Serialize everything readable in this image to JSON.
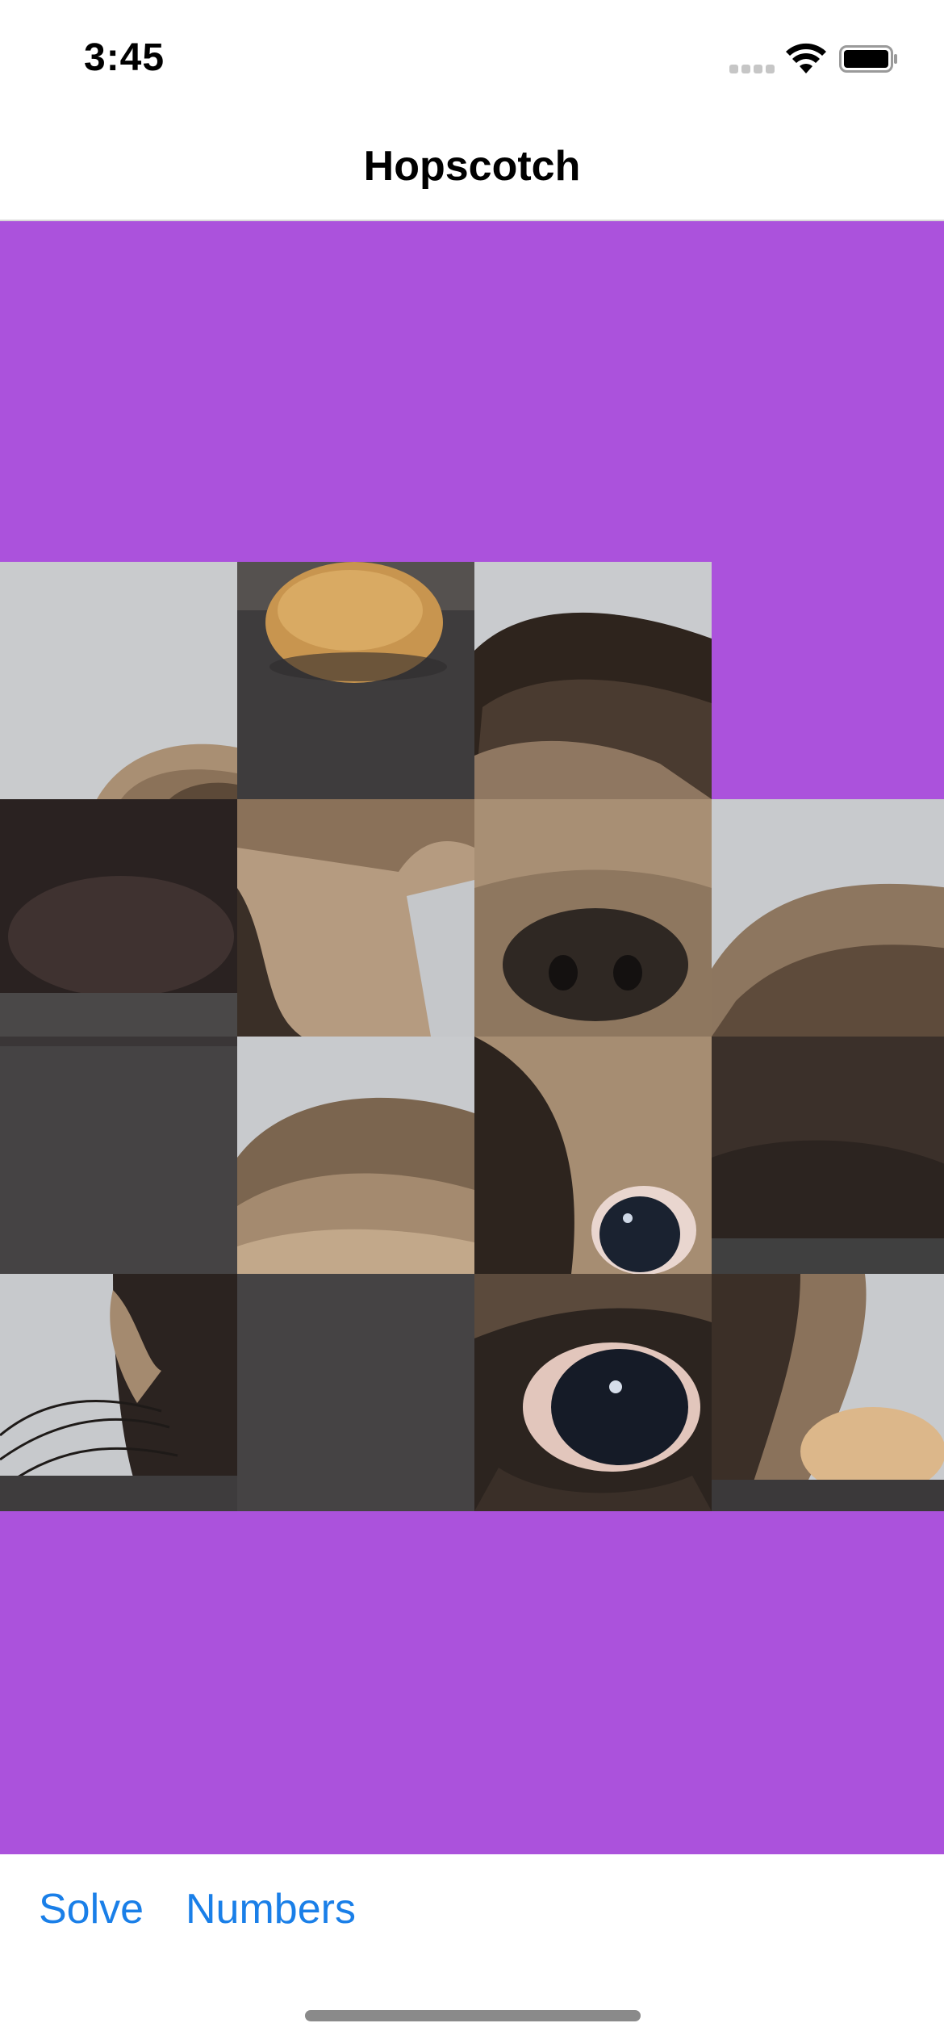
{
  "status": {
    "time": "3:45",
    "icons": [
      "cellular-signal-icon",
      "wifi-icon",
      "battery-icon"
    ]
  },
  "nav": {
    "title": "Hopscotch"
  },
  "puzzle": {
    "background_color": "#ab52dc",
    "grid_size": 4,
    "empty_tile_position": "row 1, column 4"
  },
  "toolbar": {
    "solve_label": "Solve",
    "numbers_label": "Numbers",
    "tint_color": "#1a7fe8"
  }
}
